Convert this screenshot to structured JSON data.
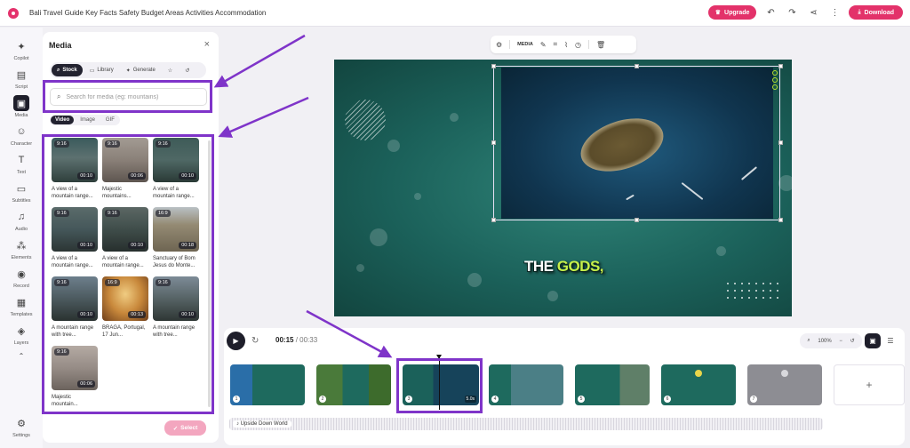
{
  "app": {
    "title": "Bali Travel Guide Key Facts Safety Budget Areas Activities Accommodation",
    "upgrade_label": "Upgrade",
    "download_label": "Download"
  },
  "rail": {
    "items": [
      {
        "label": "Copilot",
        "icon": "✦"
      },
      {
        "label": "Script",
        "icon": "▤"
      },
      {
        "label": "Media",
        "icon": "▣"
      },
      {
        "label": "Character",
        "icon": "☺"
      },
      {
        "label": "Text",
        "icon": "T"
      },
      {
        "label": "Subtitles",
        "icon": "▭"
      },
      {
        "label": "Audio",
        "icon": "♫"
      },
      {
        "label": "Elements",
        "icon": "⁂"
      },
      {
        "label": "Record",
        "icon": "◉"
      },
      {
        "label": "Templates",
        "icon": "▦"
      },
      {
        "label": "Layers",
        "icon": "◈"
      },
      {
        "label": "Settings",
        "icon": "⚙"
      }
    ],
    "active": "Media"
  },
  "media_panel": {
    "title": "Media",
    "source_tabs": [
      "Stock",
      "Library",
      "Generate"
    ],
    "active_source": "Stock",
    "search_placeholder": "Search for media (eg: mountains)",
    "type_tabs": [
      "Video",
      "Image",
      "GIF"
    ],
    "active_type": "Video",
    "select_label": "Select",
    "items": [
      {
        "ratio": "9:16",
        "duration": "00:10",
        "title": "A view of a mountain range..."
      },
      {
        "ratio": "9:16",
        "duration": "00:06",
        "title": "Majestic mountains..."
      },
      {
        "ratio": "9:16",
        "duration": "00:10",
        "title": "A view of a mountain range..."
      },
      {
        "ratio": "9:16",
        "duration": "00:10",
        "title": "A view of a mountain range..."
      },
      {
        "ratio": "9:16",
        "duration": "00:10",
        "title": "A view of a mountain range..."
      },
      {
        "ratio": "16:9",
        "duration": "00:18",
        "title": "Sanctuary of Bom Jesus do Monte..."
      },
      {
        "ratio": "9:16",
        "duration": "00:10",
        "title": "A mountain range with tree..."
      },
      {
        "ratio": "16:9",
        "duration": "00:13",
        "title": "BRAGA, Portugal, 17 Jun..."
      },
      {
        "ratio": "9:16",
        "duration": "00:10",
        "title": "A mountain range with tree..."
      },
      {
        "ratio": "9:16",
        "duration": "00:06",
        "title": "Majestic mountain..."
      }
    ]
  },
  "canvas": {
    "toolbar_label": "MEDIA",
    "caption_white": "THE ",
    "caption_highlight": "GODS,"
  },
  "timeline": {
    "current_time": "00:15",
    "total_time": "00:33",
    "zoom": "100%",
    "selected_scene_duration": "5.0s",
    "audio_track": "Upside Down World",
    "scenes": [
      "1",
      "2",
      "3",
      "4",
      "5",
      "6",
      "7"
    ],
    "add_label": "+"
  },
  "colors": {
    "brand_pink": "#e3326a",
    "annotation_purple": "#7f34c9",
    "stage_teal": "#1b615a",
    "caption_highlight": "#c6f04a"
  }
}
